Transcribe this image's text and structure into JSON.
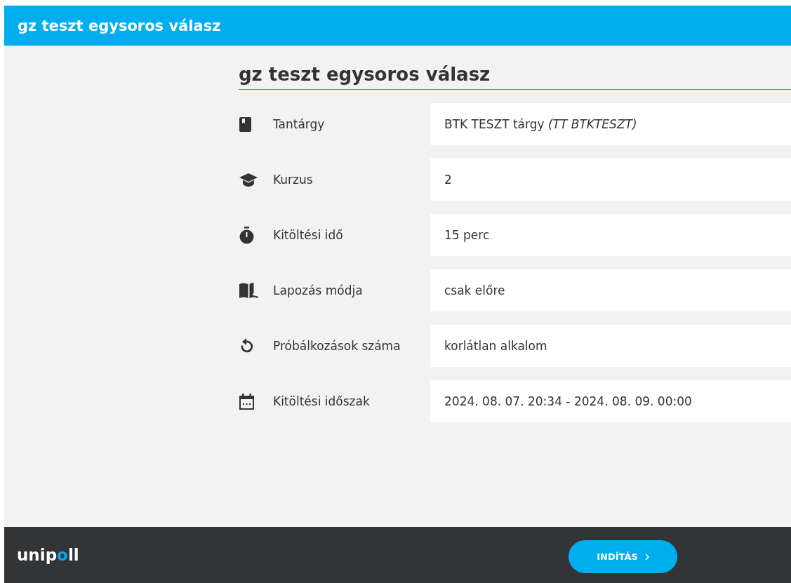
{
  "header": {
    "title": "gz teszt egysoros válasz"
  },
  "heading": "gz teszt egysoros válasz",
  "details": [
    {
      "kind": "book",
      "label": "Tantárgy",
      "value": "BTK TESZT tárgy *(TT BTKTESZT)*"
    },
    {
      "kind": "cap",
      "label": "Kurzus",
      "value": "2"
    },
    {
      "kind": "stopwatch",
      "label": "Kitöltési idő",
      "value": "15 perc"
    },
    {
      "kind": "open-book",
      "label": "Lapozás módja",
      "value": "csak előre"
    },
    {
      "kind": "undo",
      "label": "Próbálkozások száma",
      "value": "korlátlan alkalom"
    },
    {
      "kind": "calendar",
      "label": "Kitöltési időszak",
      "value": "2024. 08. 07. 20:34 - 2024. 08. 09. 00:00"
    }
  ],
  "footer": {
    "logo": {
      "before": "unip",
      "accent": "o",
      "after": "ll"
    },
    "start_button": "INDÍTÁS"
  }
}
